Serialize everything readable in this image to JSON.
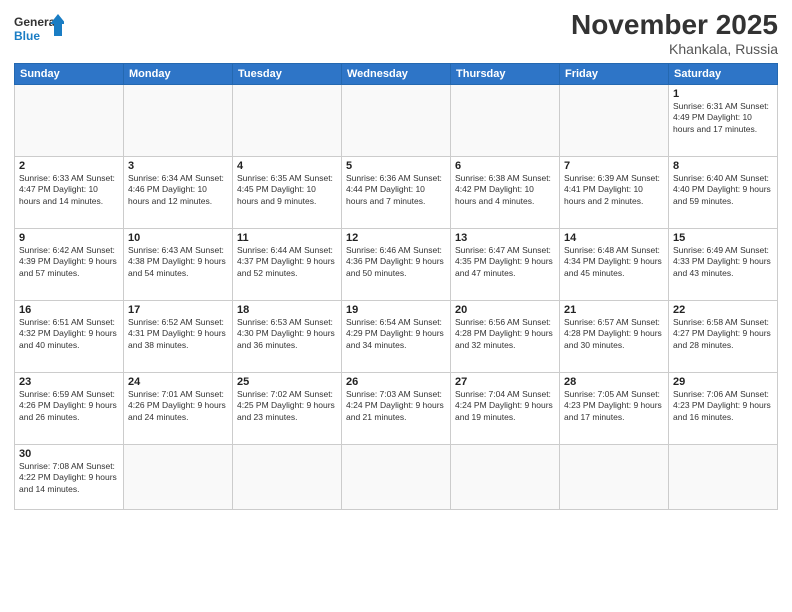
{
  "logo": {
    "general": "General",
    "blue": "Blue"
  },
  "title": "November 2025",
  "location": "Khankala, Russia",
  "days_of_week": [
    "Sunday",
    "Monday",
    "Tuesday",
    "Wednesday",
    "Thursday",
    "Friday",
    "Saturday"
  ],
  "weeks": [
    [
      {
        "day": "",
        "info": ""
      },
      {
        "day": "",
        "info": ""
      },
      {
        "day": "",
        "info": ""
      },
      {
        "day": "",
        "info": ""
      },
      {
        "day": "",
        "info": ""
      },
      {
        "day": "",
        "info": ""
      },
      {
        "day": "1",
        "info": "Sunrise: 6:31 AM\nSunset: 4:49 PM\nDaylight: 10 hours and 17 minutes."
      }
    ],
    [
      {
        "day": "2",
        "info": "Sunrise: 6:33 AM\nSunset: 4:47 PM\nDaylight: 10 hours and 14 minutes."
      },
      {
        "day": "3",
        "info": "Sunrise: 6:34 AM\nSunset: 4:46 PM\nDaylight: 10 hours and 12 minutes."
      },
      {
        "day": "4",
        "info": "Sunrise: 6:35 AM\nSunset: 4:45 PM\nDaylight: 10 hours and 9 minutes."
      },
      {
        "day": "5",
        "info": "Sunrise: 6:36 AM\nSunset: 4:44 PM\nDaylight: 10 hours and 7 minutes."
      },
      {
        "day": "6",
        "info": "Sunrise: 6:38 AM\nSunset: 4:42 PM\nDaylight: 10 hours and 4 minutes."
      },
      {
        "day": "7",
        "info": "Sunrise: 6:39 AM\nSunset: 4:41 PM\nDaylight: 10 hours and 2 minutes."
      },
      {
        "day": "8",
        "info": "Sunrise: 6:40 AM\nSunset: 4:40 PM\nDaylight: 9 hours and 59 minutes."
      }
    ],
    [
      {
        "day": "9",
        "info": "Sunrise: 6:42 AM\nSunset: 4:39 PM\nDaylight: 9 hours and 57 minutes."
      },
      {
        "day": "10",
        "info": "Sunrise: 6:43 AM\nSunset: 4:38 PM\nDaylight: 9 hours and 54 minutes."
      },
      {
        "day": "11",
        "info": "Sunrise: 6:44 AM\nSunset: 4:37 PM\nDaylight: 9 hours and 52 minutes."
      },
      {
        "day": "12",
        "info": "Sunrise: 6:46 AM\nSunset: 4:36 PM\nDaylight: 9 hours and 50 minutes."
      },
      {
        "day": "13",
        "info": "Sunrise: 6:47 AM\nSunset: 4:35 PM\nDaylight: 9 hours and 47 minutes."
      },
      {
        "day": "14",
        "info": "Sunrise: 6:48 AM\nSunset: 4:34 PM\nDaylight: 9 hours and 45 minutes."
      },
      {
        "day": "15",
        "info": "Sunrise: 6:49 AM\nSunset: 4:33 PM\nDaylight: 9 hours and 43 minutes."
      }
    ],
    [
      {
        "day": "16",
        "info": "Sunrise: 6:51 AM\nSunset: 4:32 PM\nDaylight: 9 hours and 40 minutes."
      },
      {
        "day": "17",
        "info": "Sunrise: 6:52 AM\nSunset: 4:31 PM\nDaylight: 9 hours and 38 minutes."
      },
      {
        "day": "18",
        "info": "Sunrise: 6:53 AM\nSunset: 4:30 PM\nDaylight: 9 hours and 36 minutes."
      },
      {
        "day": "19",
        "info": "Sunrise: 6:54 AM\nSunset: 4:29 PM\nDaylight: 9 hours and 34 minutes."
      },
      {
        "day": "20",
        "info": "Sunrise: 6:56 AM\nSunset: 4:28 PM\nDaylight: 9 hours and 32 minutes."
      },
      {
        "day": "21",
        "info": "Sunrise: 6:57 AM\nSunset: 4:28 PM\nDaylight: 9 hours and 30 minutes."
      },
      {
        "day": "22",
        "info": "Sunrise: 6:58 AM\nSunset: 4:27 PM\nDaylight: 9 hours and 28 minutes."
      }
    ],
    [
      {
        "day": "23",
        "info": "Sunrise: 6:59 AM\nSunset: 4:26 PM\nDaylight: 9 hours and 26 minutes."
      },
      {
        "day": "24",
        "info": "Sunrise: 7:01 AM\nSunset: 4:26 PM\nDaylight: 9 hours and 24 minutes."
      },
      {
        "day": "25",
        "info": "Sunrise: 7:02 AM\nSunset: 4:25 PM\nDaylight: 9 hours and 23 minutes."
      },
      {
        "day": "26",
        "info": "Sunrise: 7:03 AM\nSunset: 4:24 PM\nDaylight: 9 hours and 21 minutes."
      },
      {
        "day": "27",
        "info": "Sunrise: 7:04 AM\nSunset: 4:24 PM\nDaylight: 9 hours and 19 minutes."
      },
      {
        "day": "28",
        "info": "Sunrise: 7:05 AM\nSunset: 4:23 PM\nDaylight: 9 hours and 17 minutes."
      },
      {
        "day": "29",
        "info": "Sunrise: 7:06 AM\nSunset: 4:23 PM\nDaylight: 9 hours and 16 minutes."
      }
    ],
    [
      {
        "day": "30",
        "info": "Sunrise: 7:08 AM\nSunset: 4:22 PM\nDaylight: 9 hours and 14 minutes."
      },
      {
        "day": "",
        "info": ""
      },
      {
        "day": "",
        "info": ""
      },
      {
        "day": "",
        "info": ""
      },
      {
        "day": "",
        "info": ""
      },
      {
        "day": "",
        "info": ""
      },
      {
        "day": "",
        "info": ""
      }
    ]
  ]
}
